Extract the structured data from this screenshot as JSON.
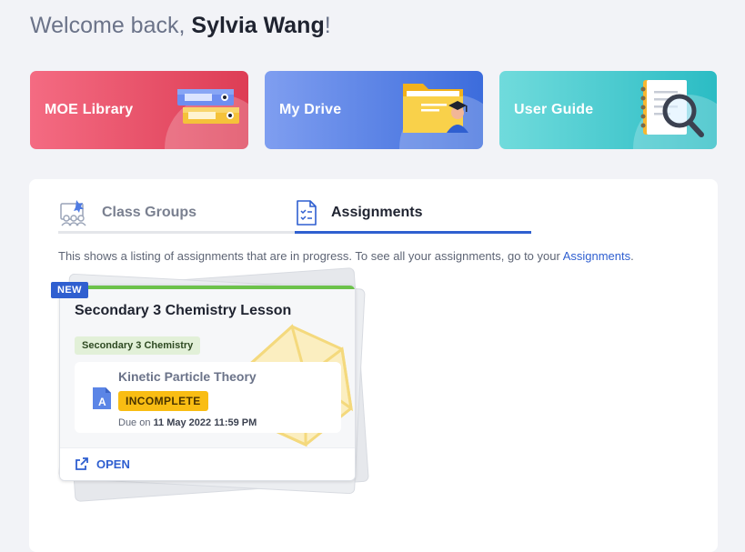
{
  "welcome": {
    "prefix": "Welcome back, ",
    "name": "Sylvia Wang",
    "suffix": "!"
  },
  "tiles": [
    {
      "label": "MOE Library",
      "icon": "binders-icon",
      "color": "#e4475f"
    },
    {
      "label": "My Drive",
      "icon": "folder-graduate-icon",
      "color": "#4f7be3"
    },
    {
      "label": "User Guide",
      "icon": "notebook-magnifier-icon",
      "color": "#3cc6cc"
    }
  ],
  "tabs": [
    {
      "label": "Class Groups",
      "icon": "class-groups-icon",
      "active": false
    },
    {
      "label": "Assignments",
      "icon": "assignments-checklist-icon",
      "active": true
    }
  ],
  "info": {
    "text": "This shows a listing of assignments that are in progress. To see all your assignments, go to your ",
    "link": "Assignments",
    "end": "."
  },
  "assignment": {
    "badge": "NEW",
    "title": "Secondary 3 Chemistry Lesson",
    "subject": "Secondary 3 Chemistry",
    "item_title": "Kinetic Particle Theory",
    "item_icon": "assignment-doc-icon",
    "status": "INCOMPLETE",
    "due_prefix": "Due on ",
    "due_date": "11 May 2022 11:59 PM",
    "open_label": "OPEN",
    "accent_color": "#6cc24a",
    "status_color": "#f9bd13"
  }
}
